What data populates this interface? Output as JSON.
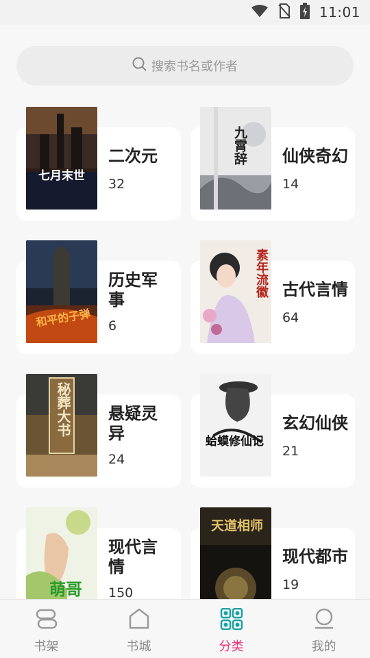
{
  "status_bar": {
    "time": "11:01"
  },
  "search": {
    "placeholder": "搜索书名或作者"
  },
  "categories": [
    {
      "name": "二次元",
      "count": "32",
      "cover_title": "七月末世"
    },
    {
      "name": "仙侠奇幻",
      "count": "14",
      "cover_title": "九霄辞"
    },
    {
      "name": "历史军事",
      "count": "6",
      "cover_title": "和平的子弹"
    },
    {
      "name": "古代言情",
      "count": "64",
      "cover_title": "素年流徽"
    },
    {
      "name": "悬疑灵异",
      "count": "24",
      "cover_title": "秘葬大书"
    },
    {
      "name": "玄幻仙侠",
      "count": "21",
      "cover_title": "蛤蟆修仙记"
    },
    {
      "name": "现代言情",
      "count": "150",
      "cover_title": "萌哥"
    },
    {
      "name": "现代都市",
      "count": "19",
      "cover_title": "天道相师"
    }
  ],
  "bottom_nav": [
    {
      "label": "书架",
      "icon": "bookshelf-icon"
    },
    {
      "label": "书城",
      "icon": "bookstore-icon"
    },
    {
      "label": "分类",
      "icon": "category-icon",
      "active": true
    },
    {
      "label": "我的",
      "icon": "profile-icon"
    }
  ],
  "colors": {
    "accent": "#e6337a",
    "nav_active_icon": "#1aa3a3"
  }
}
